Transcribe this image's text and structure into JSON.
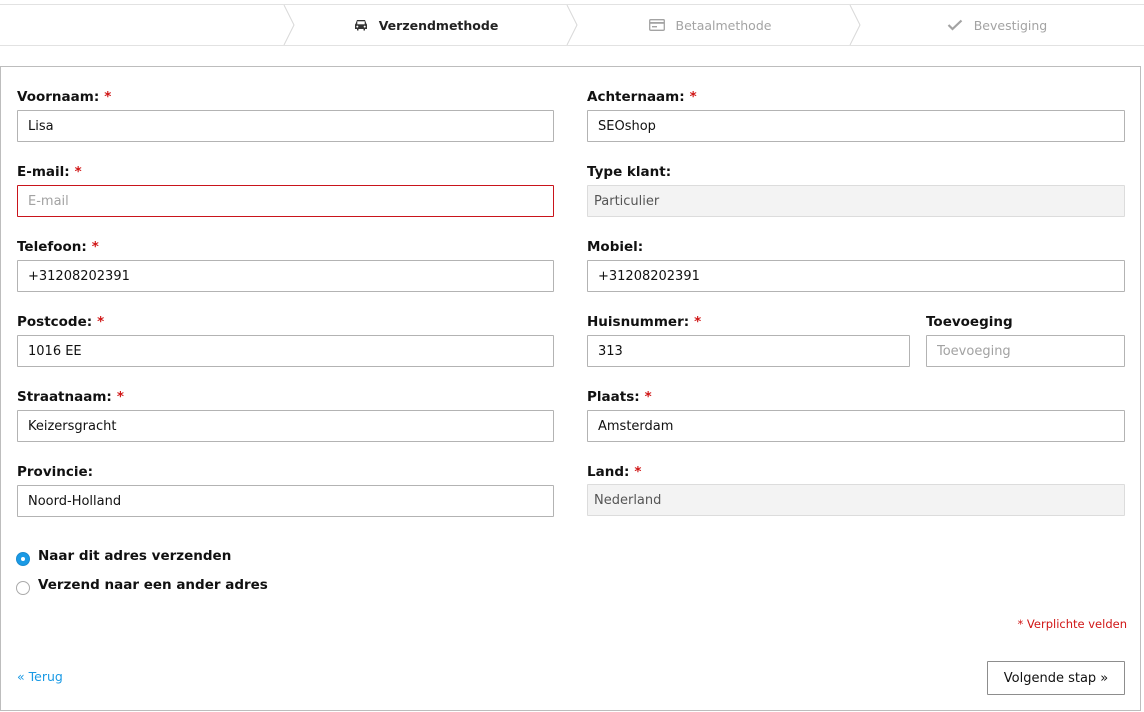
{
  "steps": [
    {
      "label": "Verzendmethode",
      "icon": "car-icon",
      "state": "active"
    },
    {
      "label": "Betaalmethode",
      "icon": "credit-card-icon",
      "state": "inactive"
    },
    {
      "label": "Bevestiging",
      "icon": "checkmark-icon",
      "state": "inactive"
    }
  ],
  "required_mark": "*",
  "form": {
    "firstname": {
      "label": "Voornaam:",
      "value": "Lisa",
      "required": true
    },
    "lastname": {
      "label": "Achternaam:",
      "value": "SEOshop",
      "required": true
    },
    "email": {
      "label": "E-mail:",
      "value": "",
      "placeholder": "E-mail",
      "required": true,
      "error": true
    },
    "customer_type": {
      "label": "Type klant:",
      "value": "Particulier",
      "readonly": true
    },
    "phone": {
      "label": "Telefoon:",
      "value": "+31208202391",
      "required": true
    },
    "mobile": {
      "label": "Mobiel:",
      "value": "+31208202391"
    },
    "zipcode": {
      "label": "Postcode:",
      "value": "1016 EE",
      "required": true
    },
    "housenumber": {
      "label": "Huisnummer:",
      "value": "313",
      "required": true
    },
    "addition": {
      "label": "Toevoeging",
      "value": "",
      "placeholder": "Toevoeging"
    },
    "street": {
      "label": "Straatnaam:",
      "value": "Keizersgracht",
      "required": true
    },
    "city": {
      "label": "Plaats:",
      "value": "Amsterdam",
      "required": true
    },
    "province": {
      "label": "Provincie:",
      "value": "Noord-Holland"
    },
    "country": {
      "label": "Land:",
      "value": "Nederland",
      "required": true,
      "readonly": true
    }
  },
  "shipping_options": [
    {
      "label": "Naar dit adres verzenden",
      "checked": true
    },
    {
      "label": "Verzend naar een ander adres",
      "checked": false
    }
  ],
  "required_note": "* Verplichte velden",
  "back_link": "« Terug",
  "next_button": "Volgende stap »",
  "colors": {
    "required": "#d01515",
    "link": "#1a9ae5",
    "error_border": "#c9141b",
    "radio_checked": "#1a9ae5"
  }
}
